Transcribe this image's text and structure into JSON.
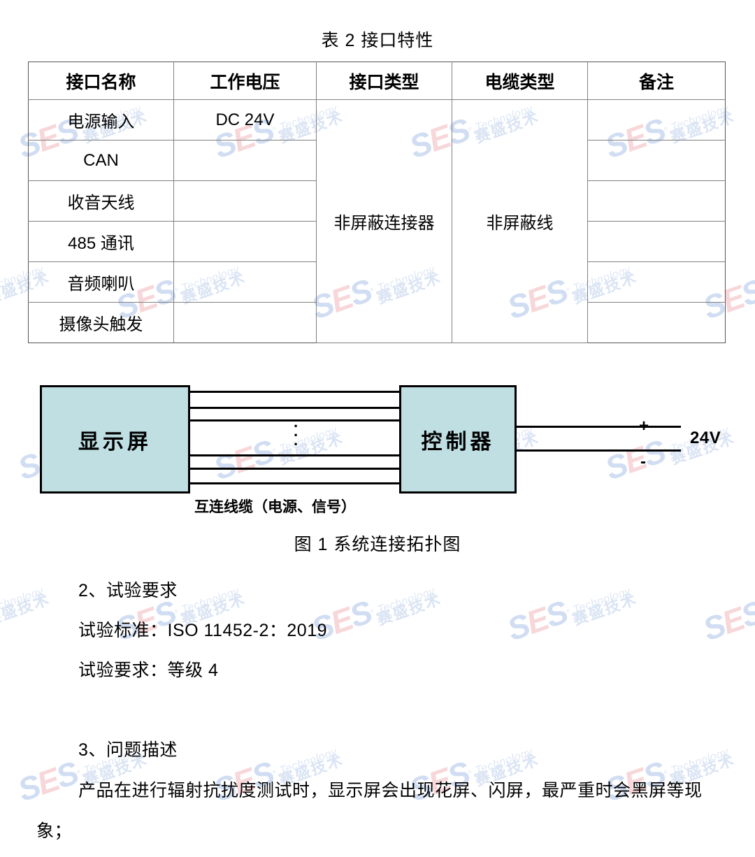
{
  "document": {
    "table_caption": "表 2 接口特性",
    "figure_caption": "图 1 系统连接拓扑图"
  },
  "table": {
    "headers": [
      "接口名称",
      "工作电压",
      "接口类型",
      "电缆类型",
      "备注"
    ],
    "rows": [
      {
        "name": "电源输入",
        "voltage": "DC 24V",
        "remark": ""
      },
      {
        "name": "CAN",
        "voltage": "",
        "remark": ""
      },
      {
        "name": "收音天线",
        "voltage": "",
        "remark": ""
      },
      {
        "name": "485 通讯",
        "voltage": "",
        "remark": ""
      },
      {
        "name": "音频喇叭",
        "voltage": "",
        "remark": ""
      },
      {
        "name": "摄像头触发",
        "voltage": "",
        "remark": ""
      }
    ],
    "merged": {
      "interface_type": "非屏蔽连接器",
      "cable_type": "非屏蔽线"
    }
  },
  "diagram": {
    "display_box": "显示屏",
    "controller_box": "控制器",
    "cable_label": "互连线缆（电源、信号）",
    "polarity_plus": "+",
    "polarity_minus": "-",
    "voltage_label": "24V",
    "ellipsis_dot": "·",
    "cable_line_count": 6,
    "box_fill_color": "#bfdfe3",
    "box_border_color": "#000000"
  },
  "sections": {
    "test_requirements_heading": "2、试验要求",
    "test_standard": "试验标准：ISO 11452-2：2019",
    "test_level": "试验要求：等级 4",
    "problem_heading": "3、问题描述",
    "problem_text": "产品在进行辐射抗扰度测试时，显示屏会出现花屏、闪屏，最严重时会黑屏等现象；"
  },
  "watermark": {
    "brand": "SES",
    "degree": "°",
    "tagline": "Technology",
    "chinese": "赛盛技术",
    "color_blue": "#cfdcf2",
    "color_pink": "#f7d5d8"
  }
}
